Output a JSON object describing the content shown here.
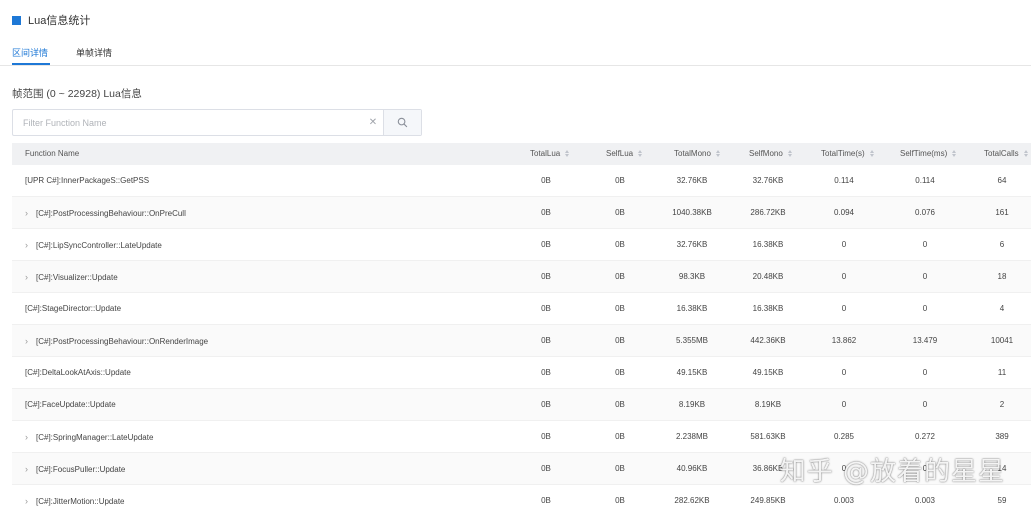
{
  "header": {
    "title": "Lua信息统计",
    "accent": "#1e78d6"
  },
  "tabs": [
    {
      "label": "区间详情",
      "active": true
    },
    {
      "label": "单帧详情",
      "active": false
    }
  ],
  "range_label": "帧范围 (0 ~ 22928) Lua信息",
  "filter": {
    "placeholder": "Filter Function Name",
    "value": ""
  },
  "table": {
    "columns": [
      "Function Name",
      "TotalLua",
      "SelfLua",
      "TotalMono",
      "SelfMono",
      "TotalTime(s)",
      "SelfTime(ms)",
      "TotalCalls"
    ],
    "rows": [
      {
        "name": "[UPR C#]:InnerPackageS::GetPSS",
        "expandable": false,
        "cells": [
          "0B",
          "0B",
          "32.76KB",
          "32.76KB",
          "0.114",
          "0.114",
          "64"
        ]
      },
      {
        "name": "[C#]:PostProcessingBehaviour::OnPreCull",
        "expandable": true,
        "cells": [
          "0B",
          "0B",
          "1040.38KB",
          "286.72KB",
          "0.094",
          "0.076",
          "161"
        ]
      },
      {
        "name": "[C#]:LipSyncController::LateUpdate",
        "expandable": true,
        "cells": [
          "0B",
          "0B",
          "32.76KB",
          "16.38KB",
          "0",
          "0",
          "6"
        ]
      },
      {
        "name": "[C#]:Visualizer::Update",
        "expandable": true,
        "cells": [
          "0B",
          "0B",
          "98.3KB",
          "20.48KB",
          "0",
          "0",
          "18"
        ]
      },
      {
        "name": "[C#]:StageDirector::Update",
        "expandable": false,
        "cells": [
          "0B",
          "0B",
          "16.38KB",
          "16.38KB",
          "0",
          "0",
          "4"
        ]
      },
      {
        "name": "[C#]:PostProcessingBehaviour::OnRenderImage",
        "expandable": true,
        "cells": [
          "0B",
          "0B",
          "5.355MB",
          "442.36KB",
          "13.862",
          "13.479",
          "10041"
        ]
      },
      {
        "name": "[C#]:DeltaLookAtAxis::Update",
        "expandable": false,
        "cells": [
          "0B",
          "0B",
          "49.15KB",
          "49.15KB",
          "0",
          "0",
          "11"
        ]
      },
      {
        "name": "[C#]:FaceUpdate::Update",
        "expandable": false,
        "cells": [
          "0B",
          "0B",
          "8.19KB",
          "8.19KB",
          "0",
          "0",
          "2"
        ]
      },
      {
        "name": "[C#]:SpringManager::LateUpdate",
        "expandable": true,
        "cells": [
          "0B",
          "0B",
          "2.238MB",
          "581.63KB",
          "0.285",
          "0.272",
          "389"
        ]
      },
      {
        "name": "[C#]:FocusPuller::Update",
        "expandable": true,
        "cells": [
          "0B",
          "0B",
          "40.96KB",
          "36.86KB",
          "0",
          "0",
          "14"
        ]
      },
      {
        "name": "[C#]:JitterMotion::Update",
        "expandable": true,
        "cells": [
          "0B",
          "0B",
          "282.62KB",
          "249.85KB",
          "0.003",
          "0.003",
          "59"
        ]
      }
    ]
  },
  "watermark": "知乎 @放着的星星"
}
